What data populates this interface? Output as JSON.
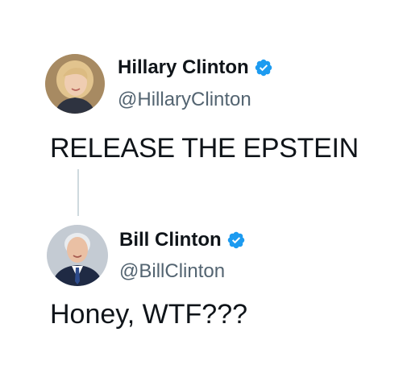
{
  "thread": {
    "tweets": [
      {
        "author_name": "Hillary Clinton",
        "handle": "@HillaryClinton",
        "verified": true,
        "text": "RELEASE THE EPSTEIN"
      },
      {
        "author_name": "Bill Clinton",
        "handle": "@BillClinton",
        "verified": true,
        "text": "Honey, WTF???"
      }
    ]
  },
  "colors": {
    "verified_badge": "#1d9bf0",
    "handle_text": "#536471",
    "body_text": "#0f1419",
    "thread_line": "#cfd9de"
  },
  "icons": [
    "verified-badge-icon",
    "avatar"
  ]
}
